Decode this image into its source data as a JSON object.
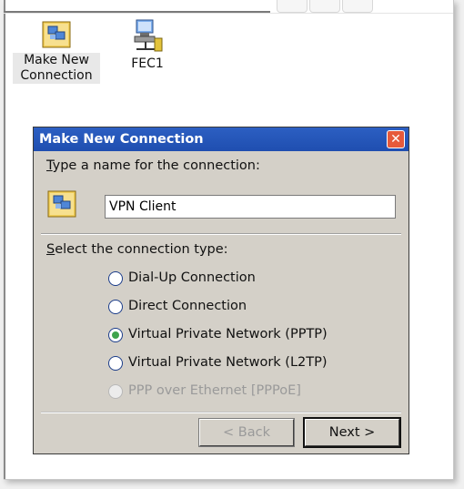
{
  "desktop": {
    "icons": [
      {
        "label_line1": "Make New",
        "label_line2": "Connection",
        "icon": "network-folder-icon"
      },
      {
        "label_line1": "FEC1",
        "icon": "network-computer-icon"
      }
    ]
  },
  "dialog": {
    "title": "Make New Connection",
    "name_prompt": "Type a name for the connection:",
    "name_value": "VPN Client",
    "type_prompt": "Select the connection type:",
    "options": [
      {
        "label": "Dial-Up Connection",
        "checked": false,
        "enabled": true
      },
      {
        "label": "Direct Connection",
        "checked": false,
        "enabled": true
      },
      {
        "label": "Virtual Private Network (PPTP)",
        "checked": true,
        "enabled": true
      },
      {
        "label": "Virtual Private Network (L2TP)",
        "checked": false,
        "enabled": true
      },
      {
        "label": "PPP over Ethernet [PPPoE]",
        "checked": false,
        "enabled": false
      }
    ],
    "back_label": "< Back",
    "next_label": "Next >",
    "close_glyph": "✕"
  }
}
